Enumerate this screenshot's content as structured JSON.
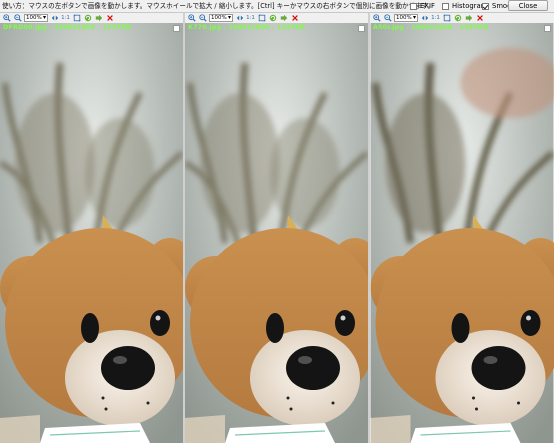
{
  "header": {
    "hint": "使い方：マウスの左ボタンで画像を動かします。マウスホイールで拡大 / 縮小します。[Ctrl] キーかマウスの右ボタンで個別に画像を動かせます。",
    "options": [
      {
        "label": "EXIF",
        "checked": false
      },
      {
        "label": "Histogram",
        "checked": false
      },
      {
        "label": "Smooth",
        "checked": true
      }
    ],
    "close_label": "Close"
  },
  "toolbar": {
    "zoom_value": "100%",
    "one_to_one_label": "1:1",
    "icons": [
      "zoom-in-icon",
      "zoom-out-icon",
      "fit-icon",
      "actual-size-icon",
      "fullscreen-icon",
      "rotate-icon",
      "next-icon",
      "close-icon"
    ]
  },
  "panels": [
    {
      "caption": "DFRD00.jpg . 1600x1600 . 1337KB"
    },
    {
      "caption": "K770.jpg . 1600x1600 . 1337KB"
    },
    {
      "caption": "A50r.jpg . 1600x1600 . 1387KB"
    }
  ],
  "colors": {
    "caption_green": "#7dff42",
    "toolbar_bg": "#f0f0f0",
    "close_red": "#d21010",
    "bear_fur": "#c48a4f",
    "muzzle": "#efe7dd",
    "nose": "#141414",
    "background_blur": "#aab2ad"
  }
}
